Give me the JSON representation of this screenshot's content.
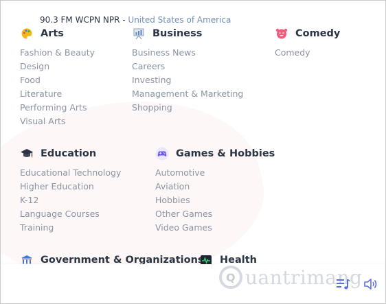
{
  "categories": {
    "arts": {
      "title": "Arts",
      "icon": "palette-icon",
      "items": [
        "Fashion & Beauty",
        "Design",
        "Food",
        "Literature",
        "Performing Arts",
        "Visual Arts"
      ]
    },
    "business": {
      "title": "Business",
      "icon": "presentation-chart-icon",
      "items": [
        "Business News",
        "Careers",
        "Investing",
        "Management & Marketing",
        "Shopping"
      ]
    },
    "comedy": {
      "title": "Comedy",
      "icon": "laughing-face-icon",
      "items": [
        "Comedy"
      ]
    },
    "education": {
      "title": "Education",
      "icon": "graduation-cap-icon",
      "items": [
        "Educational Technology",
        "Higher Education",
        "K-12",
        "Language Courses",
        "Training"
      ]
    },
    "games": {
      "title": "Games & Hobbies",
      "icon": "gamepad-icon",
      "items": [
        "Automotive",
        "Aviation",
        "Hobbies",
        "Other Games",
        "Video Games"
      ]
    },
    "government": {
      "title": "Government & Organizations",
      "icon": "government-building-icon"
    },
    "health": {
      "title": "Health",
      "icon": "heartbeat-monitor-icon"
    }
  },
  "player": {
    "station": "90.3 FM WCPN NPR",
    "separator": " - ",
    "country": "United States of America"
  },
  "watermark": {
    "text": "uantrimang"
  },
  "colors": {
    "title": "#2b3645",
    "subitem": "#8a93a3",
    "link": "#6f8fb3",
    "accent": "#5b6ee1"
  }
}
